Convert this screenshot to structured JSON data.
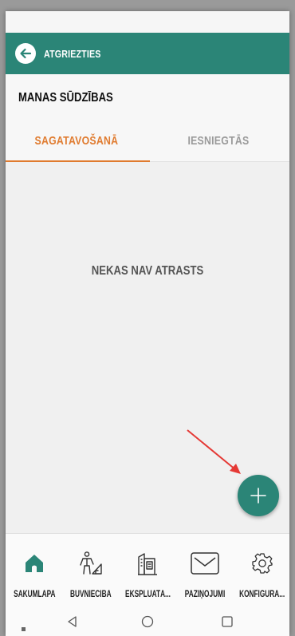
{
  "header": {
    "back_label": "ATGRIEZTIES"
  },
  "page": {
    "title": "MANAS SŪDZĪBAS"
  },
  "tabs": [
    {
      "label": "SAGATAVOŠANĀ",
      "active": true
    },
    {
      "label": "IESNIEGTĀS",
      "active": false
    }
  ],
  "content": {
    "empty_message": "NEKAS NAV ATRASTS"
  },
  "nav": {
    "items": [
      {
        "label": "SĀKUMLAPA",
        "icon": "home-icon",
        "active": true
      },
      {
        "label": "BŪVNIECĪBA",
        "icon": "construction-worker-icon",
        "active": false
      },
      {
        "label": "EKSPLUATĀ...",
        "icon": "buildings-icon",
        "active": false
      },
      {
        "label": "PAZIŅOJUMI",
        "icon": "envelope-icon",
        "active": false
      },
      {
        "label": "KONFIGURĀ...",
        "icon": "gear-icon",
        "active": false
      }
    ]
  },
  "colors": {
    "primary": "#2b8577",
    "accent": "#e07b2f",
    "annotation_arrow": "#e53935"
  }
}
